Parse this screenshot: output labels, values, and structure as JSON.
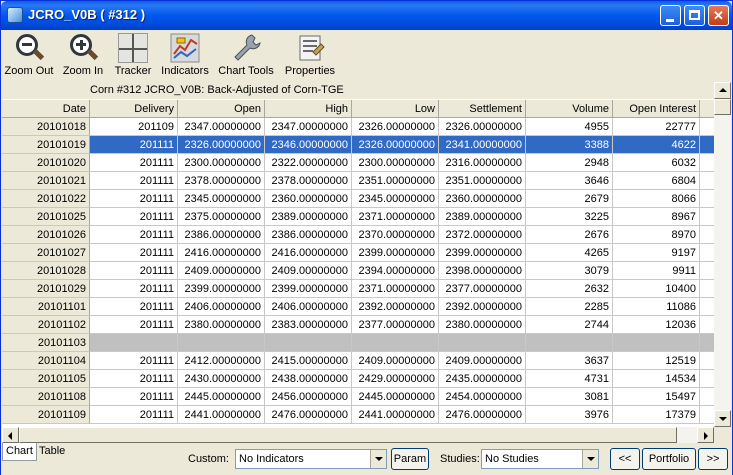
{
  "window": {
    "title": "JCRO_V0B ( #312 )"
  },
  "toolbar": {
    "items": [
      {
        "label": "Zoom Out",
        "icon": "zoom-out-icon"
      },
      {
        "label": "Zoom In",
        "icon": "zoom-in-icon"
      },
      {
        "label": "Tracker",
        "icon": "crosshair-icon"
      },
      {
        "label": "Indicators",
        "icon": "indicators-icon"
      },
      {
        "label": "Chart Tools",
        "icon": "wrench-icon"
      },
      {
        "label": "Properties",
        "icon": "properties-icon"
      }
    ]
  },
  "grid": {
    "caption": "Corn #312 JCRO_V0B: Back-Adjusted of Corn-TGE",
    "headers": [
      "Date",
      "Delivery",
      "Open",
      "High",
      "Low",
      "Settlement",
      "Volume",
      "Open Interest"
    ],
    "rows": [
      {
        "date": "20101018",
        "delivery": "201109",
        "open": "2347.00000000",
        "high": "2347.00000000",
        "low": "2326.00000000",
        "settlement": "2326.00000000",
        "volume": "4955",
        "oi": "22777",
        "state": "normal"
      },
      {
        "date": "20101019",
        "delivery": "201111",
        "open": "2326.00000000",
        "high": "2346.00000000",
        "low": "2326.00000000",
        "settlement": "2341.00000000",
        "volume": "3388",
        "oi": "4622",
        "state": "selected"
      },
      {
        "date": "20101020",
        "delivery": "201111",
        "open": "2300.00000000",
        "high": "2322.00000000",
        "low": "2300.00000000",
        "settlement": "2316.00000000",
        "volume": "2948",
        "oi": "6032",
        "state": "normal"
      },
      {
        "date": "20101021",
        "delivery": "201111",
        "open": "2378.00000000",
        "high": "2378.00000000",
        "low": "2351.00000000",
        "settlement": "2351.00000000",
        "volume": "3646",
        "oi": "6804",
        "state": "normal"
      },
      {
        "date": "20101022",
        "delivery": "201111",
        "open": "2345.00000000",
        "high": "2360.00000000",
        "low": "2345.00000000",
        "settlement": "2360.00000000",
        "volume": "2679",
        "oi": "8066",
        "state": "normal"
      },
      {
        "date": "20101025",
        "delivery": "201111",
        "open": "2375.00000000",
        "high": "2389.00000000",
        "low": "2371.00000000",
        "settlement": "2389.00000000",
        "volume": "3225",
        "oi": "8967",
        "state": "normal"
      },
      {
        "date": "20101026",
        "delivery": "201111",
        "open": "2386.00000000",
        "high": "2386.00000000",
        "low": "2370.00000000",
        "settlement": "2372.00000000",
        "volume": "2676",
        "oi": "8970",
        "state": "normal"
      },
      {
        "date": "20101027",
        "delivery": "201111",
        "open": "2416.00000000",
        "high": "2416.00000000",
        "low": "2399.00000000",
        "settlement": "2399.00000000",
        "volume": "4265",
        "oi": "9197",
        "state": "normal"
      },
      {
        "date": "20101028",
        "delivery": "201111",
        "open": "2409.00000000",
        "high": "2409.00000000",
        "low": "2394.00000000",
        "settlement": "2398.00000000",
        "volume": "3079",
        "oi": "9911",
        "state": "normal"
      },
      {
        "date": "20101029",
        "delivery": "201111",
        "open": "2399.00000000",
        "high": "2399.00000000",
        "low": "2371.00000000",
        "settlement": "2377.00000000",
        "volume": "2632",
        "oi": "10400",
        "state": "normal"
      },
      {
        "date": "20101101",
        "delivery": "201111",
        "open": "2406.00000000",
        "high": "2406.00000000",
        "low": "2392.00000000",
        "settlement": "2392.00000000",
        "volume": "2285",
        "oi": "11086",
        "state": "normal"
      },
      {
        "date": "20101102",
        "delivery": "201111",
        "open": "2380.00000000",
        "high": "2383.00000000",
        "low": "2377.00000000",
        "settlement": "2380.00000000",
        "volume": "2744",
        "oi": "12036",
        "state": "normal"
      },
      {
        "date": "20101103",
        "delivery": "",
        "open": "",
        "high": "",
        "low": "",
        "settlement": "",
        "volume": "",
        "oi": "",
        "state": "holiday"
      },
      {
        "date": "20101104",
        "delivery": "201111",
        "open": "2412.00000000",
        "high": "2415.00000000",
        "low": "2409.00000000",
        "settlement": "2409.00000000",
        "volume": "3637",
        "oi": "12519",
        "state": "normal"
      },
      {
        "date": "20101105",
        "delivery": "201111",
        "open": "2430.00000000",
        "high": "2438.00000000",
        "low": "2429.00000000",
        "settlement": "2435.00000000",
        "volume": "4731",
        "oi": "14534",
        "state": "normal"
      },
      {
        "date": "20101108",
        "delivery": "201111",
        "open": "2445.00000000",
        "high": "2456.00000000",
        "low": "2445.00000000",
        "settlement": "2454.00000000",
        "volume": "3081",
        "oi": "15497",
        "state": "normal"
      },
      {
        "date": "20101109",
        "delivery": "201111",
        "open": "2441.00000000",
        "high": "2476.00000000",
        "low": "2441.00000000",
        "settlement": "2476.00000000",
        "volume": "3976",
        "oi": "17379",
        "state": "normal"
      }
    ]
  },
  "bottom": {
    "tabs": [
      "Chart",
      "Table"
    ],
    "custom_label": "Custom:",
    "custom_value": "No Indicators",
    "param_label": "Param",
    "studies_label": "Studies:",
    "studies_value": "No Studies",
    "prev_label": "<<",
    "portfolio_label": "Portfolio",
    "next_label": ">>"
  },
  "colors": {
    "selection": "#316AC5",
    "holiday_row": "#C0C0C0",
    "titlebar": "#0058EE"
  }
}
